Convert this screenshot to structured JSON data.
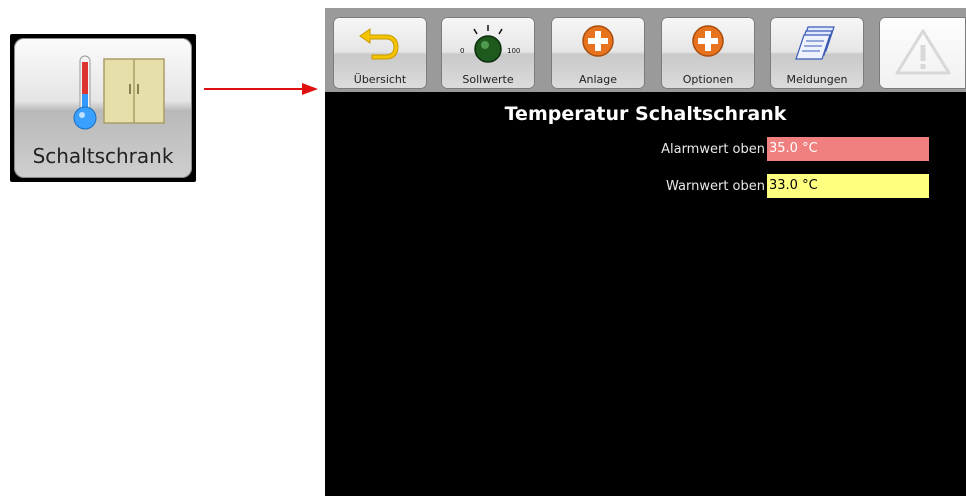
{
  "launcher": {
    "label": "Schaltschrank"
  },
  "toolbar": {
    "buttons": [
      {
        "label": "Übersicht",
        "icon": "back-arrow-icon"
      },
      {
        "label": "Sollwerte",
        "icon": "dial-knob-icon",
        "dial_min": "0",
        "dial_max": "100"
      },
      {
        "label": "Anlage",
        "icon": "plus-circle-icon"
      },
      {
        "label": "Optionen",
        "icon": "plus-circle-icon"
      },
      {
        "label": "Meldungen",
        "icon": "stacked-pages-icon"
      },
      {
        "label": "",
        "icon": "warning-triangle-icon"
      }
    ]
  },
  "screen": {
    "title": "Temperatur Schaltschrank",
    "alarm": {
      "label": "Alarmwert oben",
      "value": "35.0 °C",
      "color": "#f08080"
    },
    "warn": {
      "label": "Warnwert oben",
      "value": "33.0 °C",
      "color": "#ffff80"
    }
  },
  "colors": {
    "arrow": "#e01010",
    "screen_bg": "#000000"
  }
}
